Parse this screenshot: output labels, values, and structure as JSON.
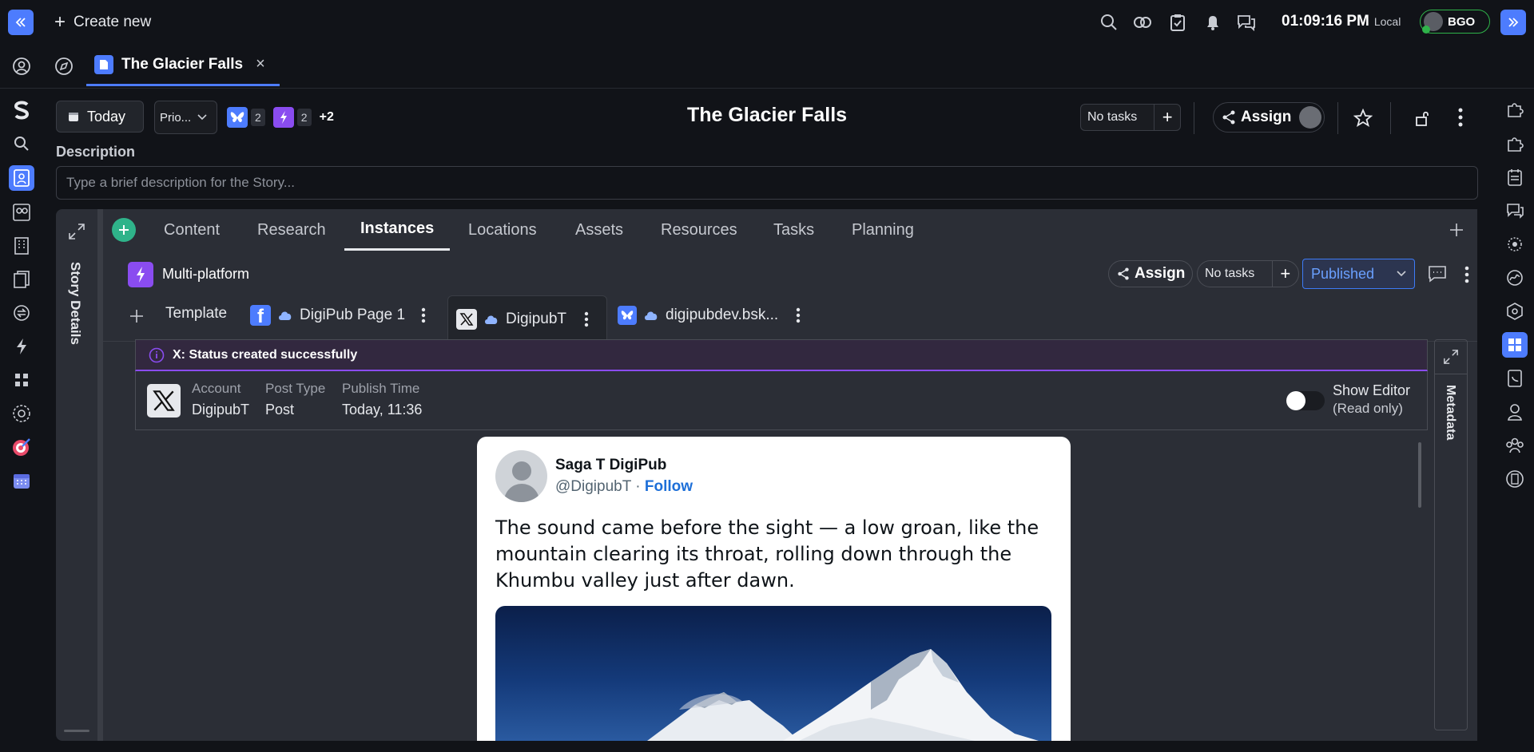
{
  "topbar": {
    "create_new": "Create new",
    "time": "01:09:16 PM",
    "time_zone": "Local",
    "user_initials": "BGO"
  },
  "tab": {
    "title": "The Glacier Falls"
  },
  "header": {
    "today_label": "Today",
    "priority_label": "Prio...",
    "bluesky_count": "2",
    "multi_count": "2",
    "more_count": "+2",
    "story_title": "The Glacier Falls",
    "no_tasks": "No tasks",
    "assign": "Assign"
  },
  "description": {
    "label": "Description",
    "placeholder": "Type a brief description for the Story..."
  },
  "story_details": "Story Details",
  "main_tabs": [
    "Content",
    "Research",
    "Instances",
    "Locations",
    "Assets",
    "Resources",
    "Tasks",
    "Planning"
  ],
  "instance": {
    "title": "Multi-platform",
    "assign": "Assign",
    "no_tasks": "No tasks",
    "status": "Published"
  },
  "sub_tabs": {
    "template": "Template",
    "facebook": "DigiPub Page 1",
    "x": "DigipubT",
    "bluesky": "digipubdev.bsk..."
  },
  "banner": {
    "text": "X: Status created successfully"
  },
  "post_meta": {
    "account_label": "Account",
    "account_value": "DigipubT",
    "type_label": "Post Type",
    "type_value": "Post",
    "time_label": "Publish Time",
    "time_value": "Today, 11:36",
    "show_editor": "Show Editor",
    "read_only": "(Read only)"
  },
  "metadata_label": "Metadata",
  "tweet": {
    "name": "Saga T DigiPub",
    "handle": "@DigipubT",
    "separator": " · ",
    "follow": "Follow",
    "text": "The sound came before the sight — a low groan, like the mountain clearing its throat, rolling down through the Khumbu valley just after dawn."
  },
  "colors": {
    "accent_blue": "#4d7cfe",
    "purple": "#8a4cf0",
    "follow_blue": "#1d6fd8",
    "banner_purple": "#6b3fd0",
    "status_blue": "#3d7bf7"
  }
}
